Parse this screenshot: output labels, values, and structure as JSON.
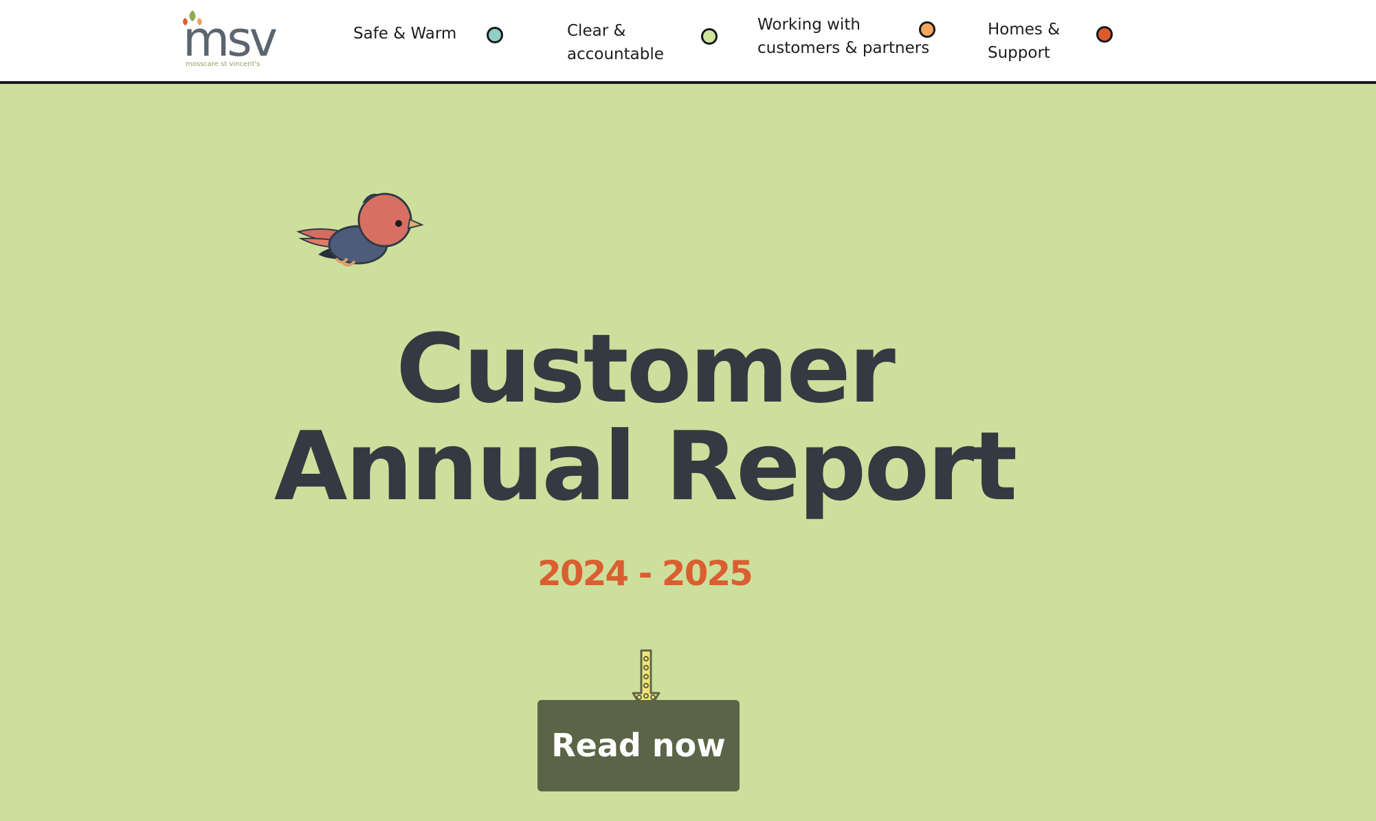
{
  "brand": {
    "logo_text": "msv",
    "logo_subtext": "mosscare st vincent's",
    "colors": {
      "background": "#cddf9c",
      "heading": "#343a41",
      "accent": "#d95f31",
      "button": "#5c6447"
    }
  },
  "nav": {
    "items": [
      {
        "label": "Safe & Warm",
        "dot_color": "#8fcfc5"
      },
      {
        "label": "Clear & accountable",
        "dot_color": "#cfe59d"
      },
      {
        "label": "Working with customers & partners",
        "dot_color": "#f2a75f"
      },
      {
        "label": "Homes & Support",
        "dot_color": "#de5a2d"
      }
    ]
  },
  "hero": {
    "title_line_1": "Customer",
    "title_line_2": "Annual Report",
    "year_range": "2024 - 2025",
    "cta_label": "Read now",
    "icons": {
      "bird": "bird-illustration-icon",
      "arrow": "down-arrow-icon"
    }
  }
}
